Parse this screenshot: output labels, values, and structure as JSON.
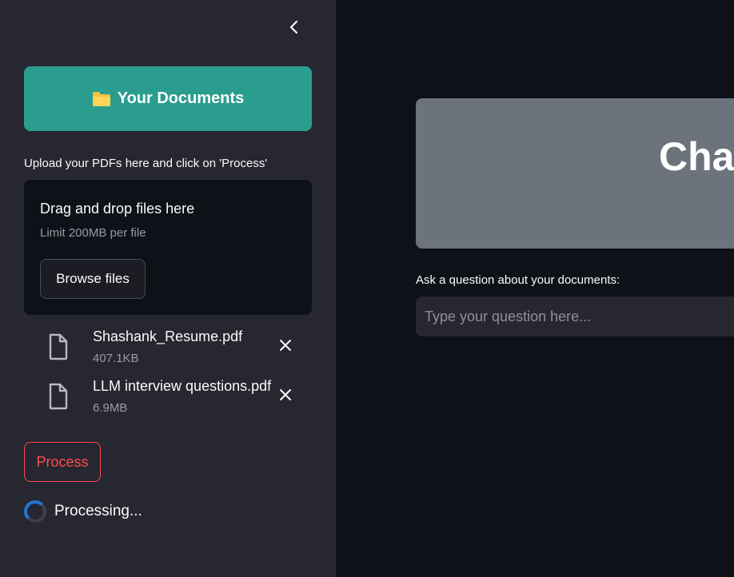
{
  "sidebar": {
    "collapse_icon": "chevron-left-icon",
    "header": {
      "icon": "folder-icon",
      "title": "Your Documents",
      "color": "#2a9d8f"
    },
    "upload_label": "Upload your PDFs here and click on 'Process'",
    "dropzone": {
      "title": "Drag and drop files here",
      "limit": "Limit 200MB per file",
      "browse_label": "Browse files"
    },
    "files": [
      {
        "name": "Shashank_Resume.pdf",
        "size": "407.1KB"
      },
      {
        "name": "LLM interview questions.pdf",
        "size": "6.9MB"
      }
    ],
    "process_label": "Process",
    "spinner_text": "Processing..."
  },
  "main": {
    "banner_title": "Chat with PDFs",
    "question_label": "Ask a question about your documents:",
    "question_placeholder": "Type your question here...",
    "question_value": ""
  },
  "colors": {
    "sidebar_bg": "#262730",
    "main_bg": "#0e1117",
    "accent_red": "#ff4b4b",
    "banner_bg": "#6c737c"
  }
}
